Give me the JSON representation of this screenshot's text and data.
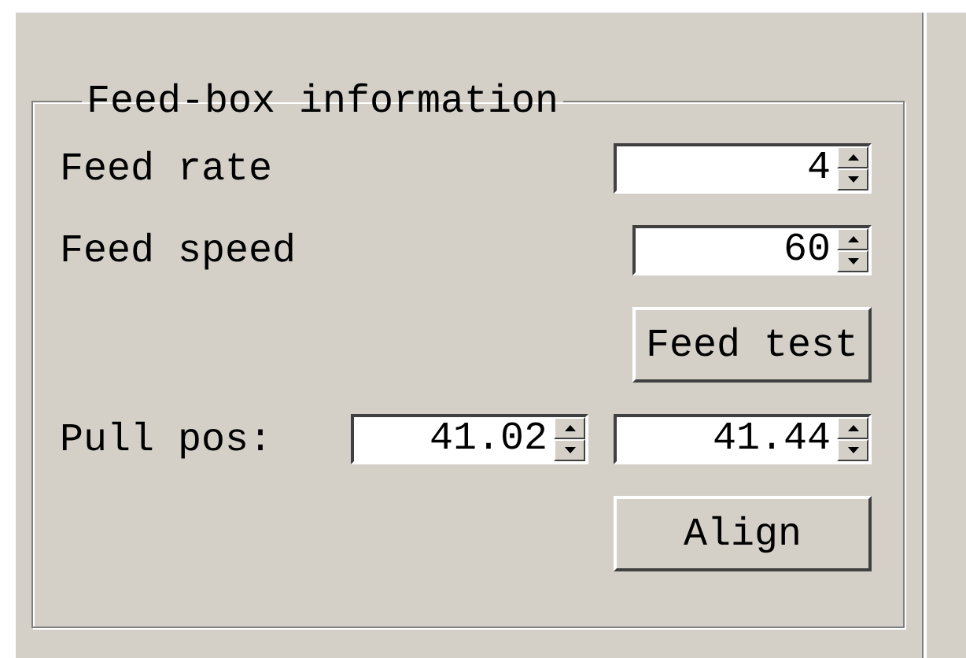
{
  "group_title": "Feed-box information",
  "feed_rate": {
    "label": "Feed rate",
    "value": "4"
  },
  "feed_speed": {
    "label": "Feed speed",
    "value": "60"
  },
  "feed_test_button": "Feed test",
  "pull_pos": {
    "label": "Pull pos:",
    "values": [
      "41.02",
      "41.44"
    ]
  },
  "align_button": "Align"
}
